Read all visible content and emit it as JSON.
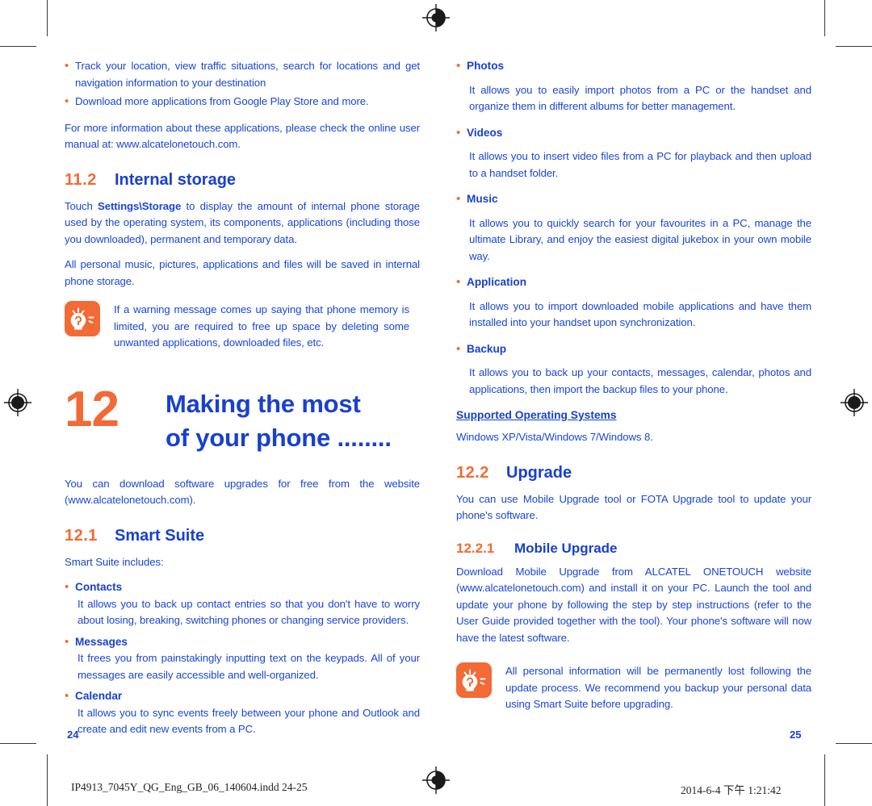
{
  "document": {
    "colors": {
      "body_blue": "#1a46d8",
      "heading_blue": "#1840d0",
      "accent_orange": "#f26a35"
    },
    "left_page": {
      "page_number": "24",
      "bullets_top": [
        "Track your location, view traffic situations, search for locations and get navigation information to your destination",
        "Download more applications from Google Play Store and more."
      ],
      "paragraph_more_info": "For more information about these applications, please check the online user manual at: www.alcatelonetouch.com.",
      "section_11_2": {
        "number": "11.2",
        "title": "Internal storage",
        "para1_prefix": "Touch ",
        "para1_bold": "Settings\\Storage",
        "para1_suffix": " to display the amount of internal phone storage used by the operating system, its components, applications (including those you downloaded), permanent and temporary data.",
        "para2": "All personal music, pictures, applications and files will be saved in internal phone storage.",
        "tip": "If a warning message comes up saying that phone memory is limited, you are required to free up space by deleting some unwanted applications, downloaded files, etc.",
        "tip_icon": "lightbulb-icon"
      },
      "chapter_12": {
        "number": "12",
        "title_line1": "Making the most",
        "title_line2": "of your phone ........"
      },
      "chapter_intro": "You can download software upgrades for free from the website (www.alcatelonetouch.com).",
      "section_12_1": {
        "number": "12.1",
        "title": "Smart Suite",
        "intro": "Smart Suite includes:",
        "items": [
          {
            "name": "Contacts",
            "description": "It allows you to back up contact entries so that you don't have to worry about losing, breaking, switching phones or changing service providers."
          },
          {
            "name": "Messages",
            "description": "It frees you from painstakingly inputting text on the keypads. All of your messages are easily accessible and well-organized."
          },
          {
            "name": "Calendar",
            "description": "It allows you to sync events freely between your phone and Outlook and create and edit new events from a PC."
          }
        ]
      }
    },
    "right_page": {
      "page_number": "25",
      "smart_suite_items": [
        {
          "name": "Photos",
          "description": "It allows you to easily import photos from a PC or the handset and organize them in different albums for better management."
        },
        {
          "name": "Videos",
          "description": "It allows you to insert video files from a PC for playback and then upload to a handset folder."
        },
        {
          "name": "Music",
          "description": "It allows you to quickly search for your favourites in a PC, manage the ultimate Library, and enjoy the easiest digital jukebox in your own mobile way."
        },
        {
          "name": "Application",
          "description": "It allows you to import downloaded mobile applications and have them installed into your handset upon synchronization."
        },
        {
          "name": "Backup",
          "description": "It allows you to back up your contacts, messages, calendar, photos and applications, then import the backup files to your phone."
        }
      ],
      "supported_os_heading": "Supported Operating Systems",
      "supported_os_value": "Windows XP/Vista/Windows 7/Windows 8.",
      "section_12_2": {
        "number": "12.2",
        "title": "Upgrade",
        "intro": "You can use Mobile Upgrade tool or FOTA Upgrade tool to update your phone's software."
      },
      "section_12_2_1": {
        "number": "12.2.1",
        "title": "Mobile Upgrade",
        "body": "Download Mobile Upgrade from ALCATEL ONETOUCH website (www.alcatelonetouch.com) and install it on your PC. Launch the tool and update your phone by following the step by step instructions (refer to the User Guide provided together with the tool). Your phone's software will now have the latest software.",
        "tip": "All personal information will be permanently lost following the update process. We recommend you backup your personal data using Smart Suite before upgrading.",
        "tip_icon": "lightbulb-icon"
      }
    },
    "footer": {
      "filename": "IP4913_7045Y_QG_Eng_GB_06_140604.indd   24-25",
      "timestamp": "2014-6-4   下午 1:21:42"
    }
  }
}
